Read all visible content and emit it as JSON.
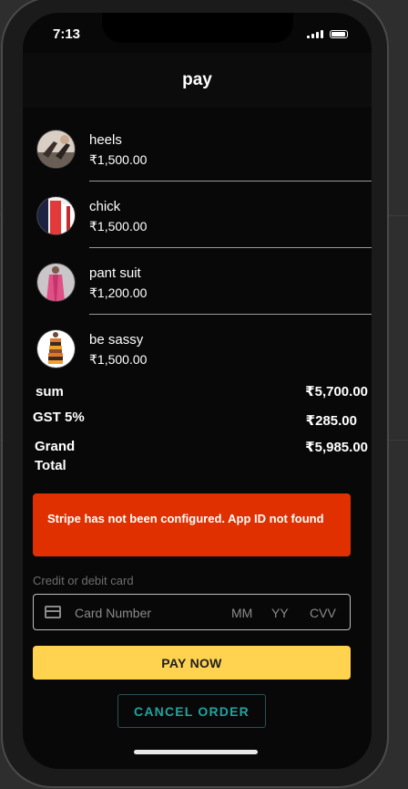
{
  "status_bar": {
    "time": "7:13"
  },
  "header": {
    "title": "pay"
  },
  "items": [
    {
      "name": "heels",
      "price": "₹1,500.00"
    },
    {
      "name": "chick",
      "price": "₹1,500.00"
    },
    {
      "name": "pant suit",
      "price": "₹1,200.00"
    },
    {
      "name": "be sassy",
      "price": "₹1,500.00"
    }
  ],
  "summary": {
    "sum_label": "sum",
    "sum_value": "₹5,700.00",
    "gst_label": "GST 5%",
    "gst_value": "₹285.00",
    "grand_label_line1": "Grand",
    "grand_label_line2": "Total",
    "grand_value": "₹5,985.00"
  },
  "alert": {
    "message": "Stripe has not been configured. App ID not found"
  },
  "card": {
    "caption": "Credit or debit card",
    "number_placeholder": "Card Number",
    "mm_placeholder": "MM",
    "yy_placeholder": "YY",
    "cvv_placeholder": "CVV"
  },
  "actions": {
    "pay_label": "PAY NOW",
    "cancel_label": "CANCEL ORDER"
  },
  "colors": {
    "alert": "#e03000",
    "pay_button": "#ffd350",
    "cancel_text": "#1fa4a1",
    "screen_bg": "#080808"
  }
}
